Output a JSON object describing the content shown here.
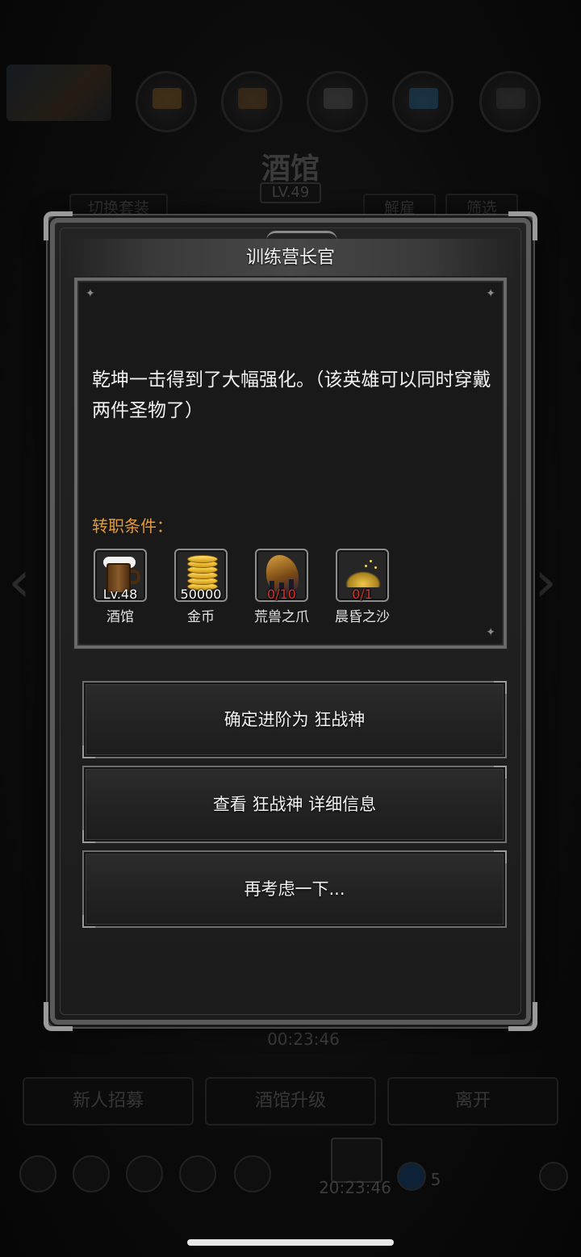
{
  "background": {
    "screen_title": "酒馆",
    "screen_level": "LV.49",
    "switch_outfit_label": "切换套装",
    "dismiss_label": "解雇",
    "filter_label": "筛选",
    "timer_middle": "00:23:46",
    "recruit_label": "新人招募",
    "upgrade_label": "酒馆升级",
    "leave_label": "离开",
    "chest_timer": "20:23:46",
    "chest_count": "5"
  },
  "dialog": {
    "title": "训练营长官",
    "description": "乾坤一击得到了大幅强化。（该英雄可以同时穿戴两件圣物了）",
    "requirements_title": "转职条件：",
    "requirements": [
      {
        "icon": "beer-mug-icon",
        "count": "Lv.48",
        "label": "酒馆",
        "met": true
      },
      {
        "icon": "gold-coins-icon",
        "count": "50000",
        "label": "金币",
        "met": true
      },
      {
        "icon": "beast-claw-icon",
        "count": "0/10",
        "label": "荒兽之爪",
        "met": false
      },
      {
        "icon": "twilight-sand-icon",
        "count": "0/1",
        "label": "晨昏之沙",
        "met": false
      }
    ],
    "buttons": {
      "confirm": "确定进阶为 狂战神",
      "details": "查看 狂战神 详细信息",
      "cancel": "再考虑一下..."
    }
  },
  "colors": {
    "requirement_title": "#e39a3a",
    "insufficient": "#e0302a",
    "panel_border": "#5a5a5a"
  }
}
